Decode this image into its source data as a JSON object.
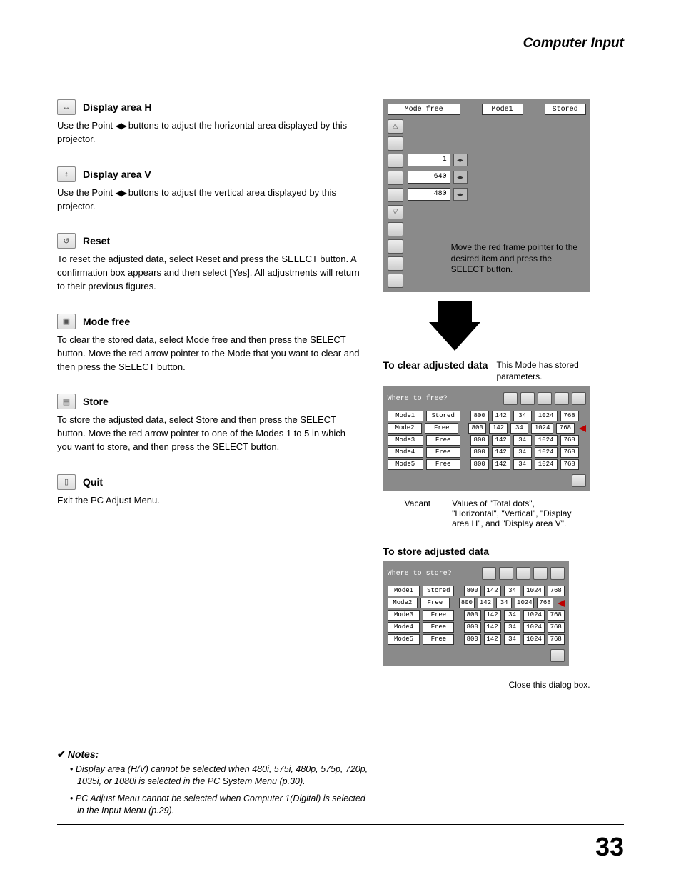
{
  "header": "Computer Input",
  "page_number": "33",
  "sections": {
    "displayH": {
      "title": "Display area H",
      "body_pre": "Use the Point ",
      "body_post": " buttons to adjust the horizontal area displayed by this projector."
    },
    "displayV": {
      "title": "Display area V",
      "body_pre": "Use the Point ",
      "body_post": " buttons to adjust the vertical area displayed by this projector."
    },
    "reset": {
      "title": "Reset",
      "body": "To reset the adjusted data, select Reset and press the SELECT button. A confirmation box appears and then select [Yes]. All adjustments will return to their previous figures."
    },
    "modeFree": {
      "title": "Mode free",
      "body": "To clear the stored data, select Mode free and then press the SELECT button. Move the red arrow pointer to the Mode that you want to clear and then press the SELECT button."
    },
    "store": {
      "title": "Store",
      "body": "To store the adjusted data, select Store and then press the SELECT button. Move the red arrow pointer to one of the Modes 1 to 5 in which you want to store, and then press the SELECT button."
    },
    "quit": {
      "title": "Quit",
      "body": "Exit the PC Adjust Menu."
    }
  },
  "osd1": {
    "top": {
      "left": "Mode free",
      "mid": "Mode1",
      "right": "Stored"
    },
    "values": {
      "v1": "1",
      "v2": "640",
      "v3": "480"
    },
    "caption": "Move the red frame pointer to the desired item and press the SELECT button."
  },
  "clear": {
    "heading": "To clear adjusted data",
    "side_note": "This Mode has stored parameters.",
    "table_title": "Where to free?",
    "rows": [
      {
        "name": "Mode1",
        "status": "Stored",
        "a": "800",
        "b": "142",
        "c": "34",
        "d": "1024",
        "e": "768"
      },
      {
        "name": "Mode2",
        "status": "Free",
        "a": "800",
        "b": "142",
        "c": "34",
        "d": "1024",
        "e": "768"
      },
      {
        "name": "Mode3",
        "status": "Free",
        "a": "800",
        "b": "142",
        "c": "34",
        "d": "1024",
        "e": "768"
      },
      {
        "name": "Mode4",
        "status": "Free",
        "a": "800",
        "b": "142",
        "c": "34",
        "d": "1024",
        "e": "768"
      },
      {
        "name": "Mode5",
        "status": "Free",
        "a": "800",
        "b": "142",
        "c": "34",
        "d": "1024",
        "e": "768"
      }
    ],
    "callout_vacant": "Vacant",
    "callout_values": "Values of \"Total dots\", \"Horizontal\", \"Vertical\", \"Display area H\", and \"Display area V\"."
  },
  "store_panel": {
    "heading": "To store adjusted data",
    "table_title": "Where to store?",
    "rows": [
      {
        "name": "Mode1",
        "status": "Stored",
        "a": "800",
        "b": "142",
        "c": "34",
        "d": "1024",
        "e": "768"
      },
      {
        "name": "Mode2",
        "status": "Free",
        "a": "800",
        "b": "142",
        "c": "34",
        "d": "1024",
        "e": "768"
      },
      {
        "name": "Mode3",
        "status": "Free",
        "a": "800",
        "b": "142",
        "c": "34",
        "d": "1024",
        "e": "768"
      },
      {
        "name": "Mode4",
        "status": "Free",
        "a": "800",
        "b": "142",
        "c": "34",
        "d": "1024",
        "e": "768"
      },
      {
        "name": "Mode5",
        "status": "Free",
        "a": "800",
        "b": "142",
        "c": "34",
        "d": "1024",
        "e": "768"
      }
    ],
    "close_caption": "Close this dialog box."
  },
  "notes": {
    "title": "Notes:",
    "items": [
      "Display area (H/V) cannot be selected when 480i, 575i, 480p, 575p, 720p, 1035i, or 1080i is selected in the PC System Menu (p.30).",
      "PC Adjust Menu cannot be selected when Computer 1(Digital) is selected in the Input Menu (p.29)."
    ]
  }
}
